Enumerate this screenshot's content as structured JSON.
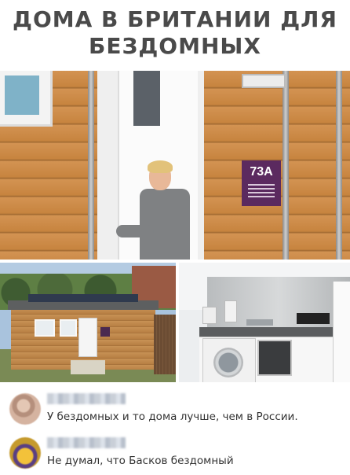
{
  "title": {
    "line1": "ДОМА В БРИТАНИИ ДЛЯ",
    "line2": "БЕЗДОМНЫХ"
  },
  "photos": {
    "main": {
      "plaque_number": "73A"
    }
  },
  "comments": [
    {
      "text": "У бездомных и то дома лучше, чем в России."
    },
    {
      "text": "Не думал, что Басков бездомный"
    }
  ]
}
